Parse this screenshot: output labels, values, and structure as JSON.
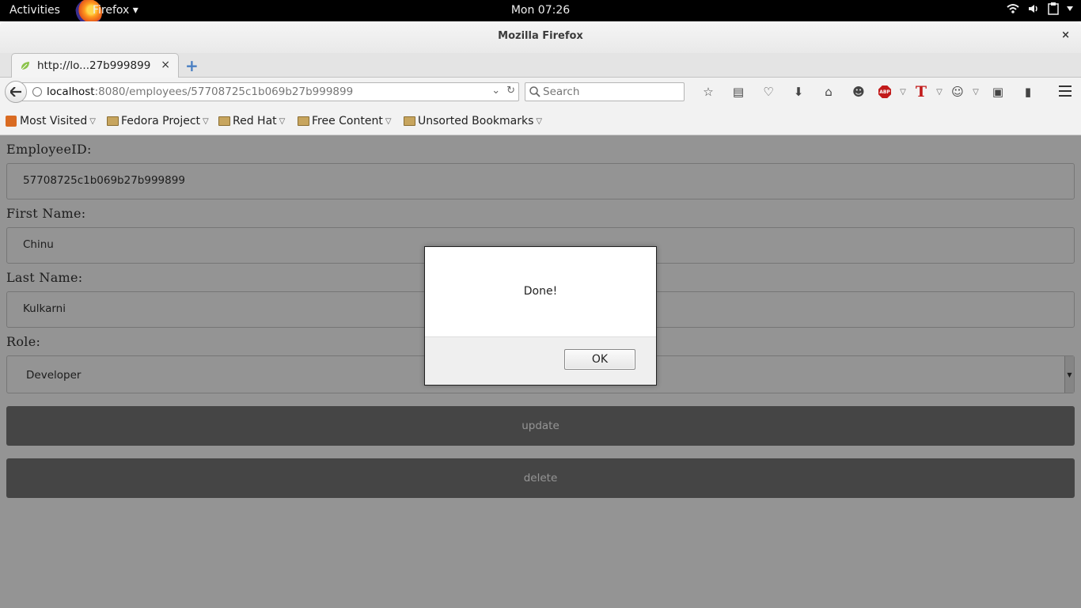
{
  "topbar": {
    "activities": "Activities",
    "app_menu": "Firefox ▾",
    "clock": "Mon 07:26"
  },
  "window": {
    "title": "Mozilla Firefox",
    "close": "×"
  },
  "tab": {
    "label": "http://lo...27b999899",
    "close": "×",
    "new_tab": "+"
  },
  "urlbar": {
    "host": "localhost",
    "rest": ":8080/employees/57708725c1b069b27b999899"
  },
  "search": {
    "placeholder": "Search"
  },
  "bookmarks": [
    {
      "label": "Most Visited"
    },
    {
      "label": "Fedora Project"
    },
    {
      "label": "Red Hat"
    },
    {
      "label": "Free Content"
    },
    {
      "label": "Unsorted Bookmarks"
    }
  ],
  "form": {
    "employee_id_label": "EmployeeID:",
    "employee_id_value": "57708725c1b069b27b999899",
    "first_name_label": "First Name:",
    "first_name_value": "Chinu",
    "last_name_label": "Last Name:",
    "last_name_value": "Kulkarni",
    "role_label": "Role:",
    "role_value": "Developer",
    "update_label": "update",
    "delete_label": "delete"
  },
  "dialog": {
    "message": "Done!",
    "ok_label": "OK"
  },
  "colors": {
    "overlay": "rgba(0,0,0,0.42)",
    "abp_red": "#c21a1a",
    "button_gray": "#777777"
  }
}
